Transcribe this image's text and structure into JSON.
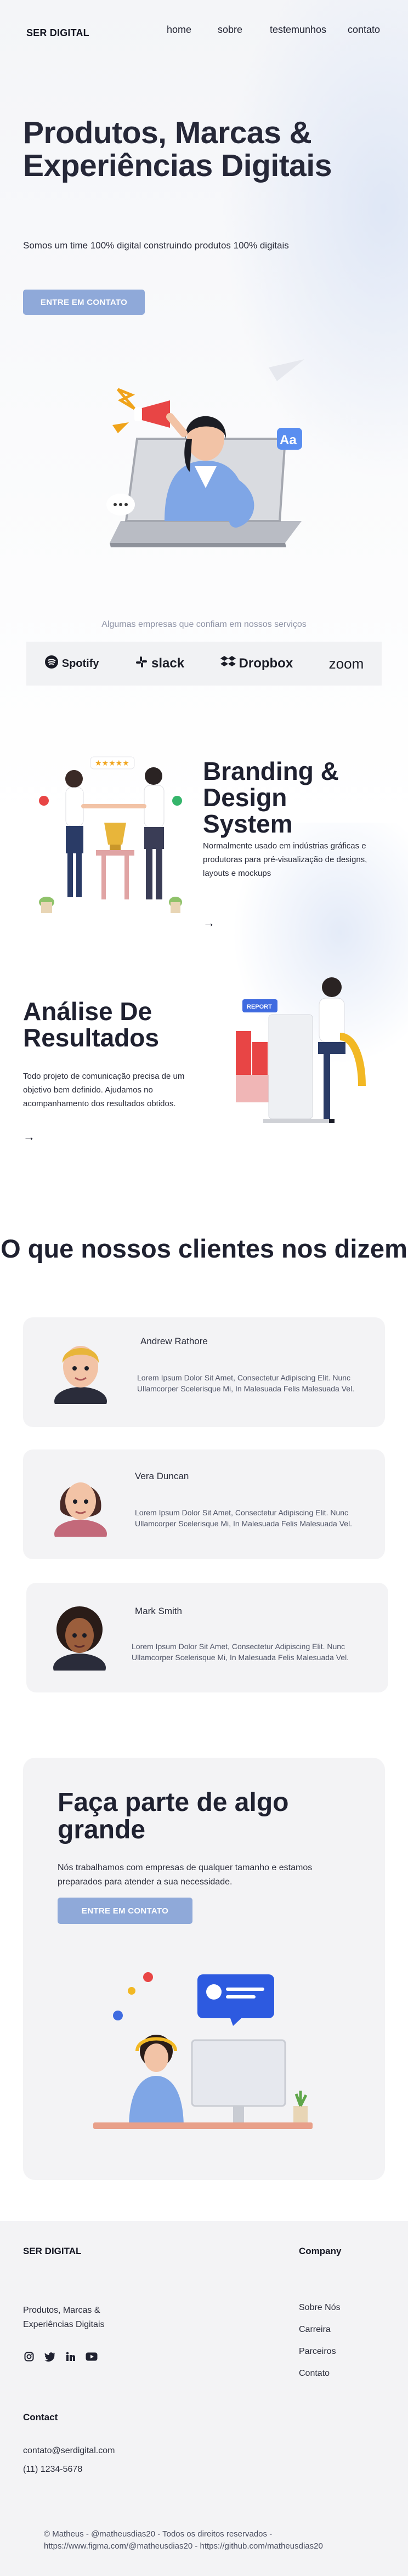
{
  "header": {
    "logo": "SER DIGITAL",
    "nav": [
      "home",
      "sobre",
      "testemunhos",
      "contato"
    ]
  },
  "hero": {
    "title": "Produtos, Marcas & Experiências Digitais",
    "subtitle": "Somos um time 100% digital construindo produtos 100% digitais",
    "button": "ENTRE EM CONTATO"
  },
  "partners": {
    "caption": "Algumas empresas que confiam em nossos serviços",
    "logos": [
      "Spotify",
      "slack",
      "Dropbox",
      "zoom"
    ]
  },
  "features": [
    {
      "title": "Branding & Design System",
      "description": "Normalmente usado em indústrias gráficas e produtoras para pré-visualização de designs, layouts e mockups",
      "arrow": "→"
    },
    {
      "title": "Análise De Resultados",
      "description": "Todo projeto de comunicação precisa de um objetivo bem definido. Ajudamos no acompanhamento dos resultados obtidos.",
      "arrow": "→"
    }
  ],
  "testimonials": {
    "title": "O que nossos clientes nos dizem",
    "items": [
      {
        "name": "Andrew Rathore",
        "text": "Lorem Ipsum Dolor Sit Amet, Consectetur Adipiscing Elit. Nunc Ullamcorper Scelerisque Mi, In Malesuada Felis Malesuada Vel."
      },
      {
        "name": "Vera Duncan",
        "text": "Lorem Ipsum Dolor Sit Amet, Consectetur Adipiscing Elit. Nunc Ullamcorper Scelerisque Mi, In Malesuada Felis Malesuada Vel."
      },
      {
        "name": "Mark Smith",
        "text": "Lorem Ipsum Dolor Sit Amet, Consectetur Adipiscing Elit. Nunc Ullamcorper Scelerisque Mi, In Malesuada Felis Malesuada Vel."
      }
    ]
  },
  "cta": {
    "title": "Faça parte de algo grande",
    "text": "Nós trabalhamos com empresas de qualquer tamanho e estamos preparados para atender a sua necessidade.",
    "button": "ENTRE EM CONTATO"
  },
  "footer": {
    "brand": "SER DIGITAL",
    "tagline": "Produtos, Marcas & Experiências Digitais",
    "social_icons": [
      "instagram-icon",
      "twitter-icon",
      "linkedin-icon",
      "youtube-icon"
    ],
    "company_title": "Company",
    "company_links": [
      "Sobre Nós",
      "Carreira",
      "Parceiros",
      "Contato"
    ],
    "contact_title": "Contact",
    "email": "contato@serdigital.com",
    "phone": "(11) 1234-5678",
    "copyright": "© Matheus - @matheusdias20 - Todos os direitos reservados - https://www.figma.com/@matheusdias20 - https://github.com/matheusdias20"
  },
  "illustrations": {
    "hero_badge": "Aa",
    "report_label": "REPORT",
    "stars": "★★★★★"
  },
  "colors": {
    "accent": "#8fa9d9",
    "card_bg": "#f3f3f5",
    "text": "#1f2130",
    "hero_wash": "#dfe7f6"
  }
}
